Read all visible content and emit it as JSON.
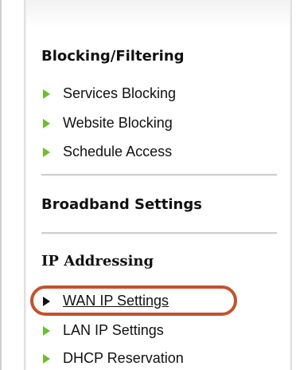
{
  "sections": {
    "blocking": {
      "title": "Blocking/Filtering",
      "items": [
        {
          "label": "Services Blocking"
        },
        {
          "label": "Website Blocking"
        },
        {
          "label": "Schedule Access"
        }
      ]
    },
    "broadband": {
      "title": "Broadband Settings"
    },
    "ip": {
      "title": "IP Addressing",
      "items": [
        {
          "label": "WAN IP Settings"
        },
        {
          "label": "LAN IP Settings"
        },
        {
          "label": "DHCP Reservation"
        }
      ]
    }
  },
  "colors": {
    "arrow_green": "#6cbf2a",
    "arrow_selected": "#111111",
    "highlight_ring": "#c0532e"
  },
  "icons": {
    "bullet": "triangle-right-icon"
  }
}
